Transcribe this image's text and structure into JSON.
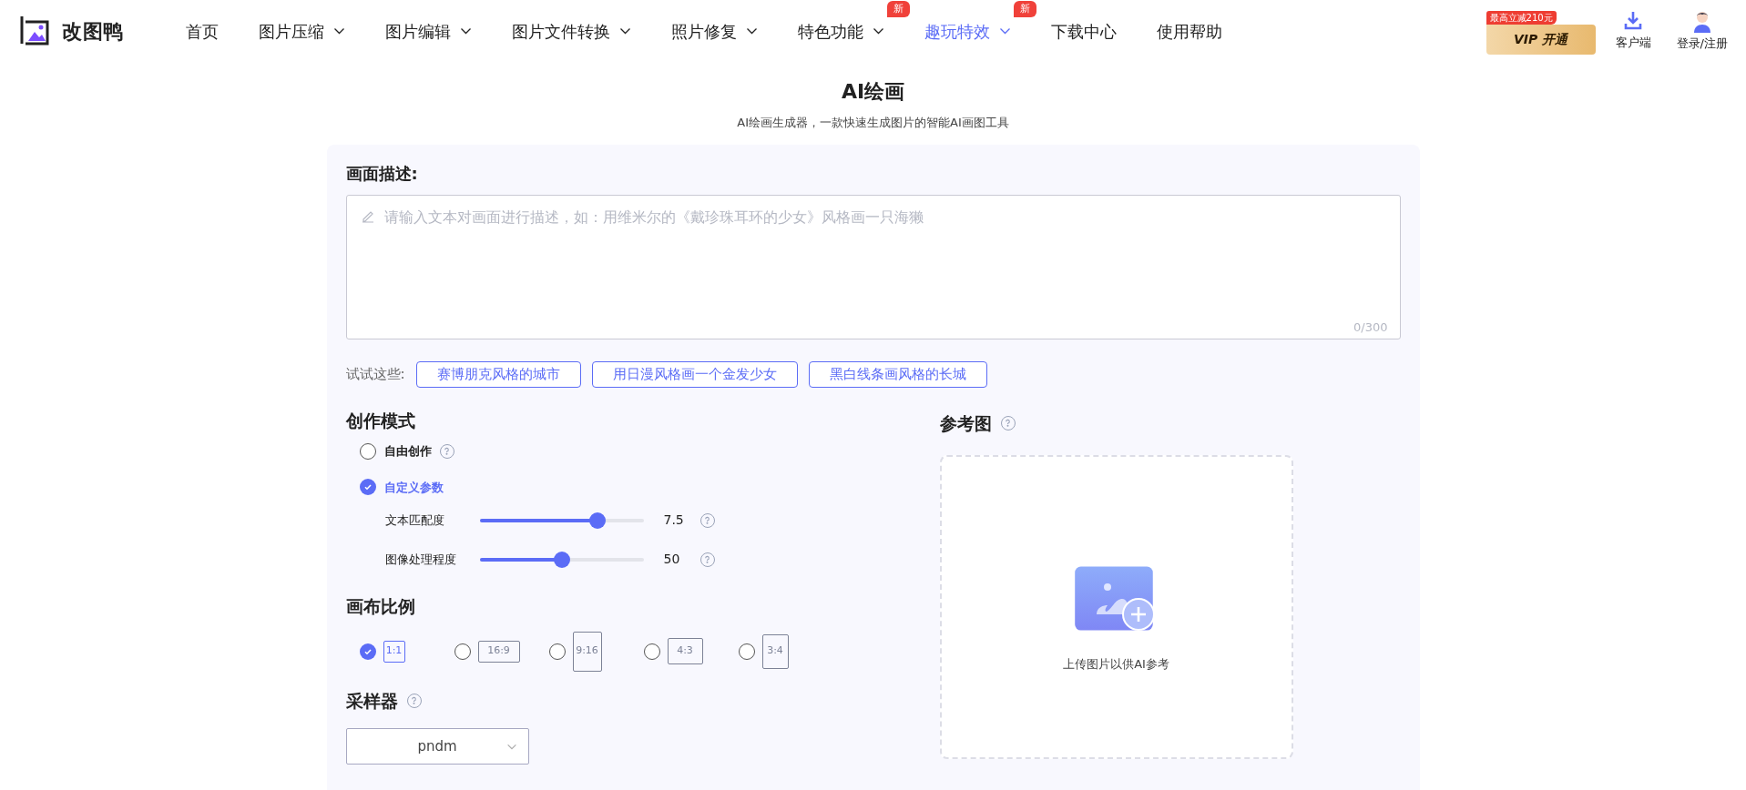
{
  "header": {
    "logo_text": "改图鸭",
    "nav": [
      {
        "label": "首页",
        "kind": "link",
        "selected": false
      },
      {
        "label": "图片压缩",
        "kind": "menu",
        "selected": false
      },
      {
        "label": "图片编辑",
        "kind": "menu",
        "selected": false
      },
      {
        "label": "图片文件转换",
        "kind": "menu",
        "selected": false
      },
      {
        "label": "照片修复",
        "kind": "menu",
        "selected": false
      },
      {
        "label": "特色功能",
        "kind": "menu",
        "selected": false,
        "badge": "新"
      },
      {
        "label": "趣玩特效",
        "kind": "menu",
        "selected": true,
        "badge": "新"
      },
      {
        "label": "下载中心",
        "kind": "link",
        "selected": false
      },
      {
        "label": "使用帮助",
        "kind": "link",
        "selected": false
      }
    ],
    "vip": {
      "promo": "最高立减210元",
      "label": "VIP 开通"
    },
    "client": "客户端",
    "login": "登录/注册"
  },
  "page": {
    "title": "AI绘画",
    "subtitle": "AI绘画生成器，一款快速生成图片的智能AI画图工具"
  },
  "description": {
    "label": "画面描述:",
    "placeholder": "请输入文本对画面进行描述，如：用维米尔的《戴珍珠耳环的少女》风格画一只海獭",
    "counter": "0/300"
  },
  "suggestions": {
    "label": "试试这些:",
    "items": [
      "赛博朋克风格的城市",
      "用日漫风格画一个金发少女",
      "黑白线条画风格的长城"
    ]
  },
  "mode": {
    "title": "创作模式",
    "options": [
      {
        "label": "自由创作",
        "selected": false,
        "help": true
      },
      {
        "label": "自定义参数",
        "selected": true,
        "help": false
      }
    ],
    "sliders": [
      {
        "label": "文本匹配度",
        "level": 0.72,
        "reading": "7.5"
      },
      {
        "label": "图像处理程度",
        "level": 0.5,
        "reading": "50"
      }
    ]
  },
  "ratio": {
    "title": "画布比例",
    "options": [
      {
        "label": "1:1",
        "kind": "square",
        "selected": true
      },
      {
        "label": "16:9",
        "kind": "wide",
        "selected": false
      },
      {
        "label": "9:16",
        "kind": "tall",
        "selected": false
      },
      {
        "label": "4:3",
        "kind": "landscape",
        "selected": false
      },
      {
        "label": "3:4",
        "kind": "portrait",
        "selected": false
      }
    ]
  },
  "sampler": {
    "title": "采样器",
    "value": "pndm"
  },
  "reference": {
    "title": "参考图",
    "upload_text": "上传图片以供AI参考"
  }
}
